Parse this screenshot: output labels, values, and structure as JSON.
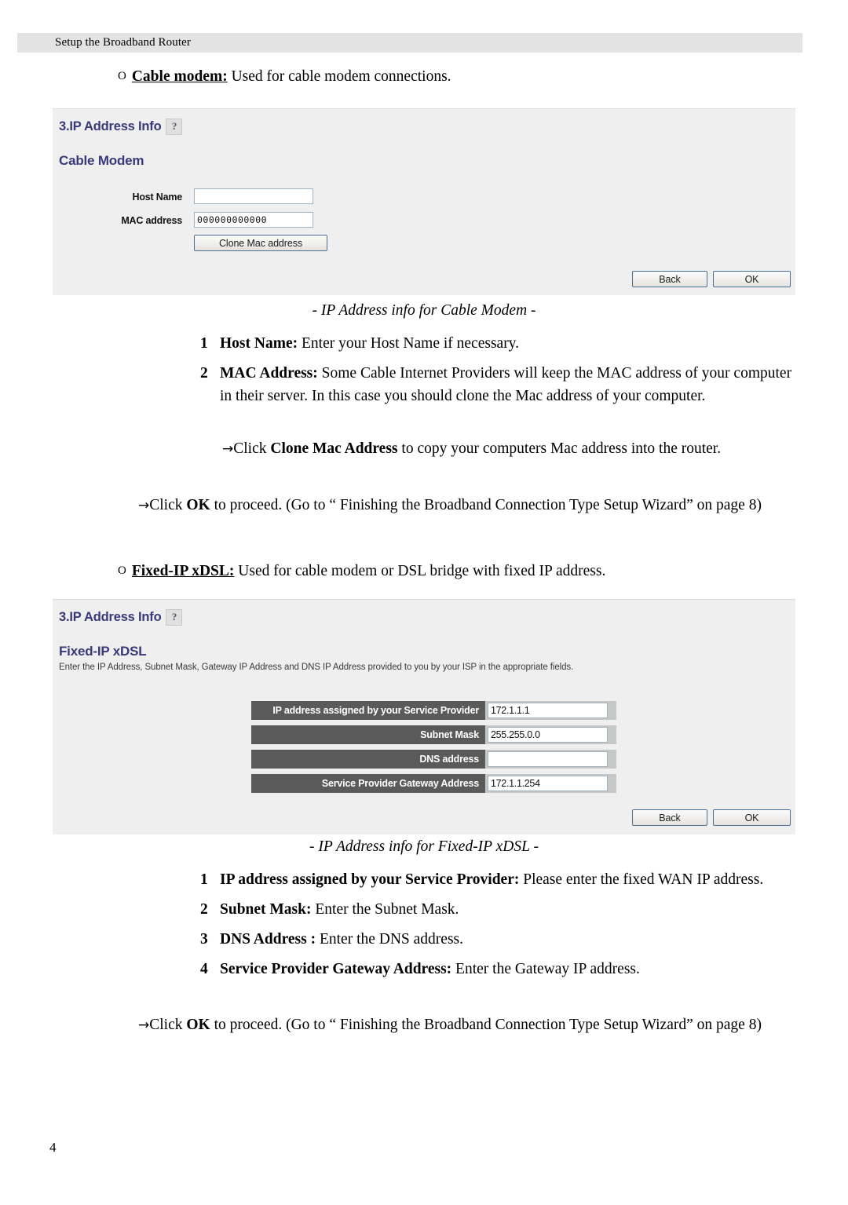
{
  "header": {
    "running_title": "Setup the Broadband Router"
  },
  "page_number": "4",
  "intro_cable": {
    "bullet": "O",
    "term": "Cable modem:",
    "rest": " Used for cable modem connections."
  },
  "panel_cable": {
    "title": "3.IP Address Info",
    "help_icon": "?",
    "subtitle": "Cable Modem",
    "fields": {
      "host_name_label": "Host Name",
      "host_name_value": "",
      "mac_label": "MAC address",
      "mac_value": "000000000000"
    },
    "buttons": {
      "clone": "Clone Mac address",
      "back": "Back",
      "ok": "OK"
    }
  },
  "caption_cable": "- IP Address info for Cable Modem -",
  "list_cable": [
    {
      "num": "1",
      "bold": "Host Name:",
      "text": " Enter your Host Name if necessary."
    },
    {
      "num": "2",
      "bold": "MAC Address:",
      "text": " Some Cable Internet Providers will keep the MAC address of your computer in their server. In this case you should clone the Mac address of your computer."
    }
  ],
  "note_clone": {
    "arrow": "→",
    "pre": "Click ",
    "bold": "Clone Mac Address",
    "post": " to copy your computers Mac address into the router."
  },
  "note_ok_cable": {
    "arrow": "→",
    "pre": "Click ",
    "bold": "OK",
    "post": " to proceed. (Go to “ Finishing the Broadband Connection Type Setup Wizard” on page 8)"
  },
  "intro_fixed": {
    "bullet": "O",
    "term": "Fixed-IP xDSL:",
    "rest": " Used for cable modem or DSL bridge with fixed IP address."
  },
  "panel_fixed": {
    "title": "3.IP Address Info",
    "help_icon": "?",
    "subtitle": "Fixed-IP xDSL",
    "description": "Enter the IP Address, Subnet Mask, Gateway IP Address and DNS IP Address provided to you by your ISP in the appropriate fields.",
    "rows": [
      {
        "label": "IP address assigned by your Service Provider",
        "value": "172.1.1.1"
      },
      {
        "label": "Subnet Mask",
        "value": "255.255.0.0"
      },
      {
        "label": "DNS address",
        "value": ""
      },
      {
        "label": "Service Provider Gateway Address",
        "value": "172.1.1.254"
      }
    ],
    "buttons": {
      "back": "Back",
      "ok": "OK"
    }
  },
  "caption_fixed": "- IP Address info for Fixed-IP xDSL -",
  "list_fixed": [
    {
      "num": "1",
      "bold": "IP address assigned by your Service Provider:",
      "text": " Please enter the fixed WAN IP address."
    },
    {
      "num": "2",
      "bold": "Subnet Mask:",
      "text": " Enter the Subnet Mask."
    },
    {
      "num": "3",
      "bold": "DNS Address :",
      "text": " Enter the DNS address."
    },
    {
      "num": "4",
      "bold": "Service Provider Gateway Address:",
      "text": " Enter the Gateway IP address."
    }
  ],
  "note_ok_fixed": {
    "arrow": "→",
    "pre": "Click ",
    "bold": "OK",
    "post": " to proceed. (Go to “ Finishing the Broadband Connection Type Setup Wizard” on page 8)"
  },
  "colors": {
    "panel_bg": "#efefef",
    "title_blue": "#39397a",
    "row_label_gray": "#5a5a5a",
    "row_wrap_gray": "#c8c8c8",
    "header_band": "#e3e3e3"
  }
}
